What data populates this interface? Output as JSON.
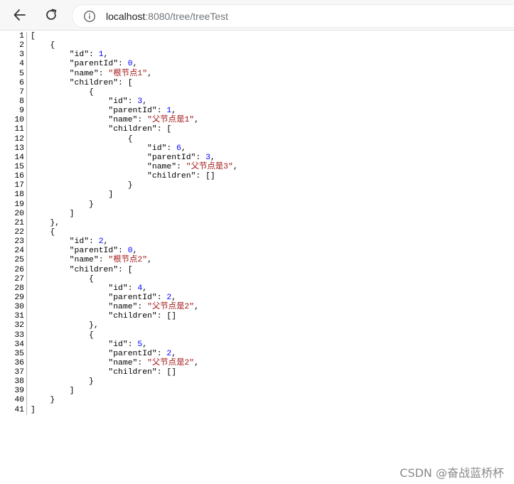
{
  "browser": {
    "back_icon": "arrow-left-icon",
    "reload_icon": "reload-icon",
    "info_icon": "info-circle-icon",
    "url_host": "localhost",
    "url_path": ":8080/tree/treeTest"
  },
  "json_view": {
    "lines": [
      "[",
      "    {",
      "        \"id\": 1,",
      "        \"parentId\": 0,",
      "        \"name\": \"根节点1\",",
      "        \"children\": [",
      "            {",
      "                \"id\": 3,",
      "                \"parentId\": 1,",
      "                \"name\": \"父节点是1\",",
      "                \"children\": [",
      "                    {",
      "                        \"id\": 6,",
      "                        \"parentId\": 3,",
      "                        \"name\": \"父节点是3\",",
      "                        \"children\": []",
      "                    }",
      "                ]",
      "            }",
      "        ]",
      "    },",
      "    {",
      "        \"id\": 2,",
      "        \"parentId\": 0,",
      "        \"name\": \"根节点2\",",
      "        \"children\": [",
      "            {",
      "                \"id\": 4,",
      "                \"parentId\": 2,",
      "                \"name\": \"父节点是2\",",
      "                \"children\": []",
      "            },",
      "            {",
      "                \"id\": 5,",
      "                \"parentId\": 2,",
      "                \"name\": \"父节点是2\",",
      "                \"children\": []",
      "            }",
      "        ]",
      "    }",
      "]"
    ]
  },
  "watermark": {
    "text": "CSDN @奋战蓝桥杯"
  },
  "colors": {
    "number": "#0000ff",
    "string": "#a31515",
    "text": "#000000"
  }
}
